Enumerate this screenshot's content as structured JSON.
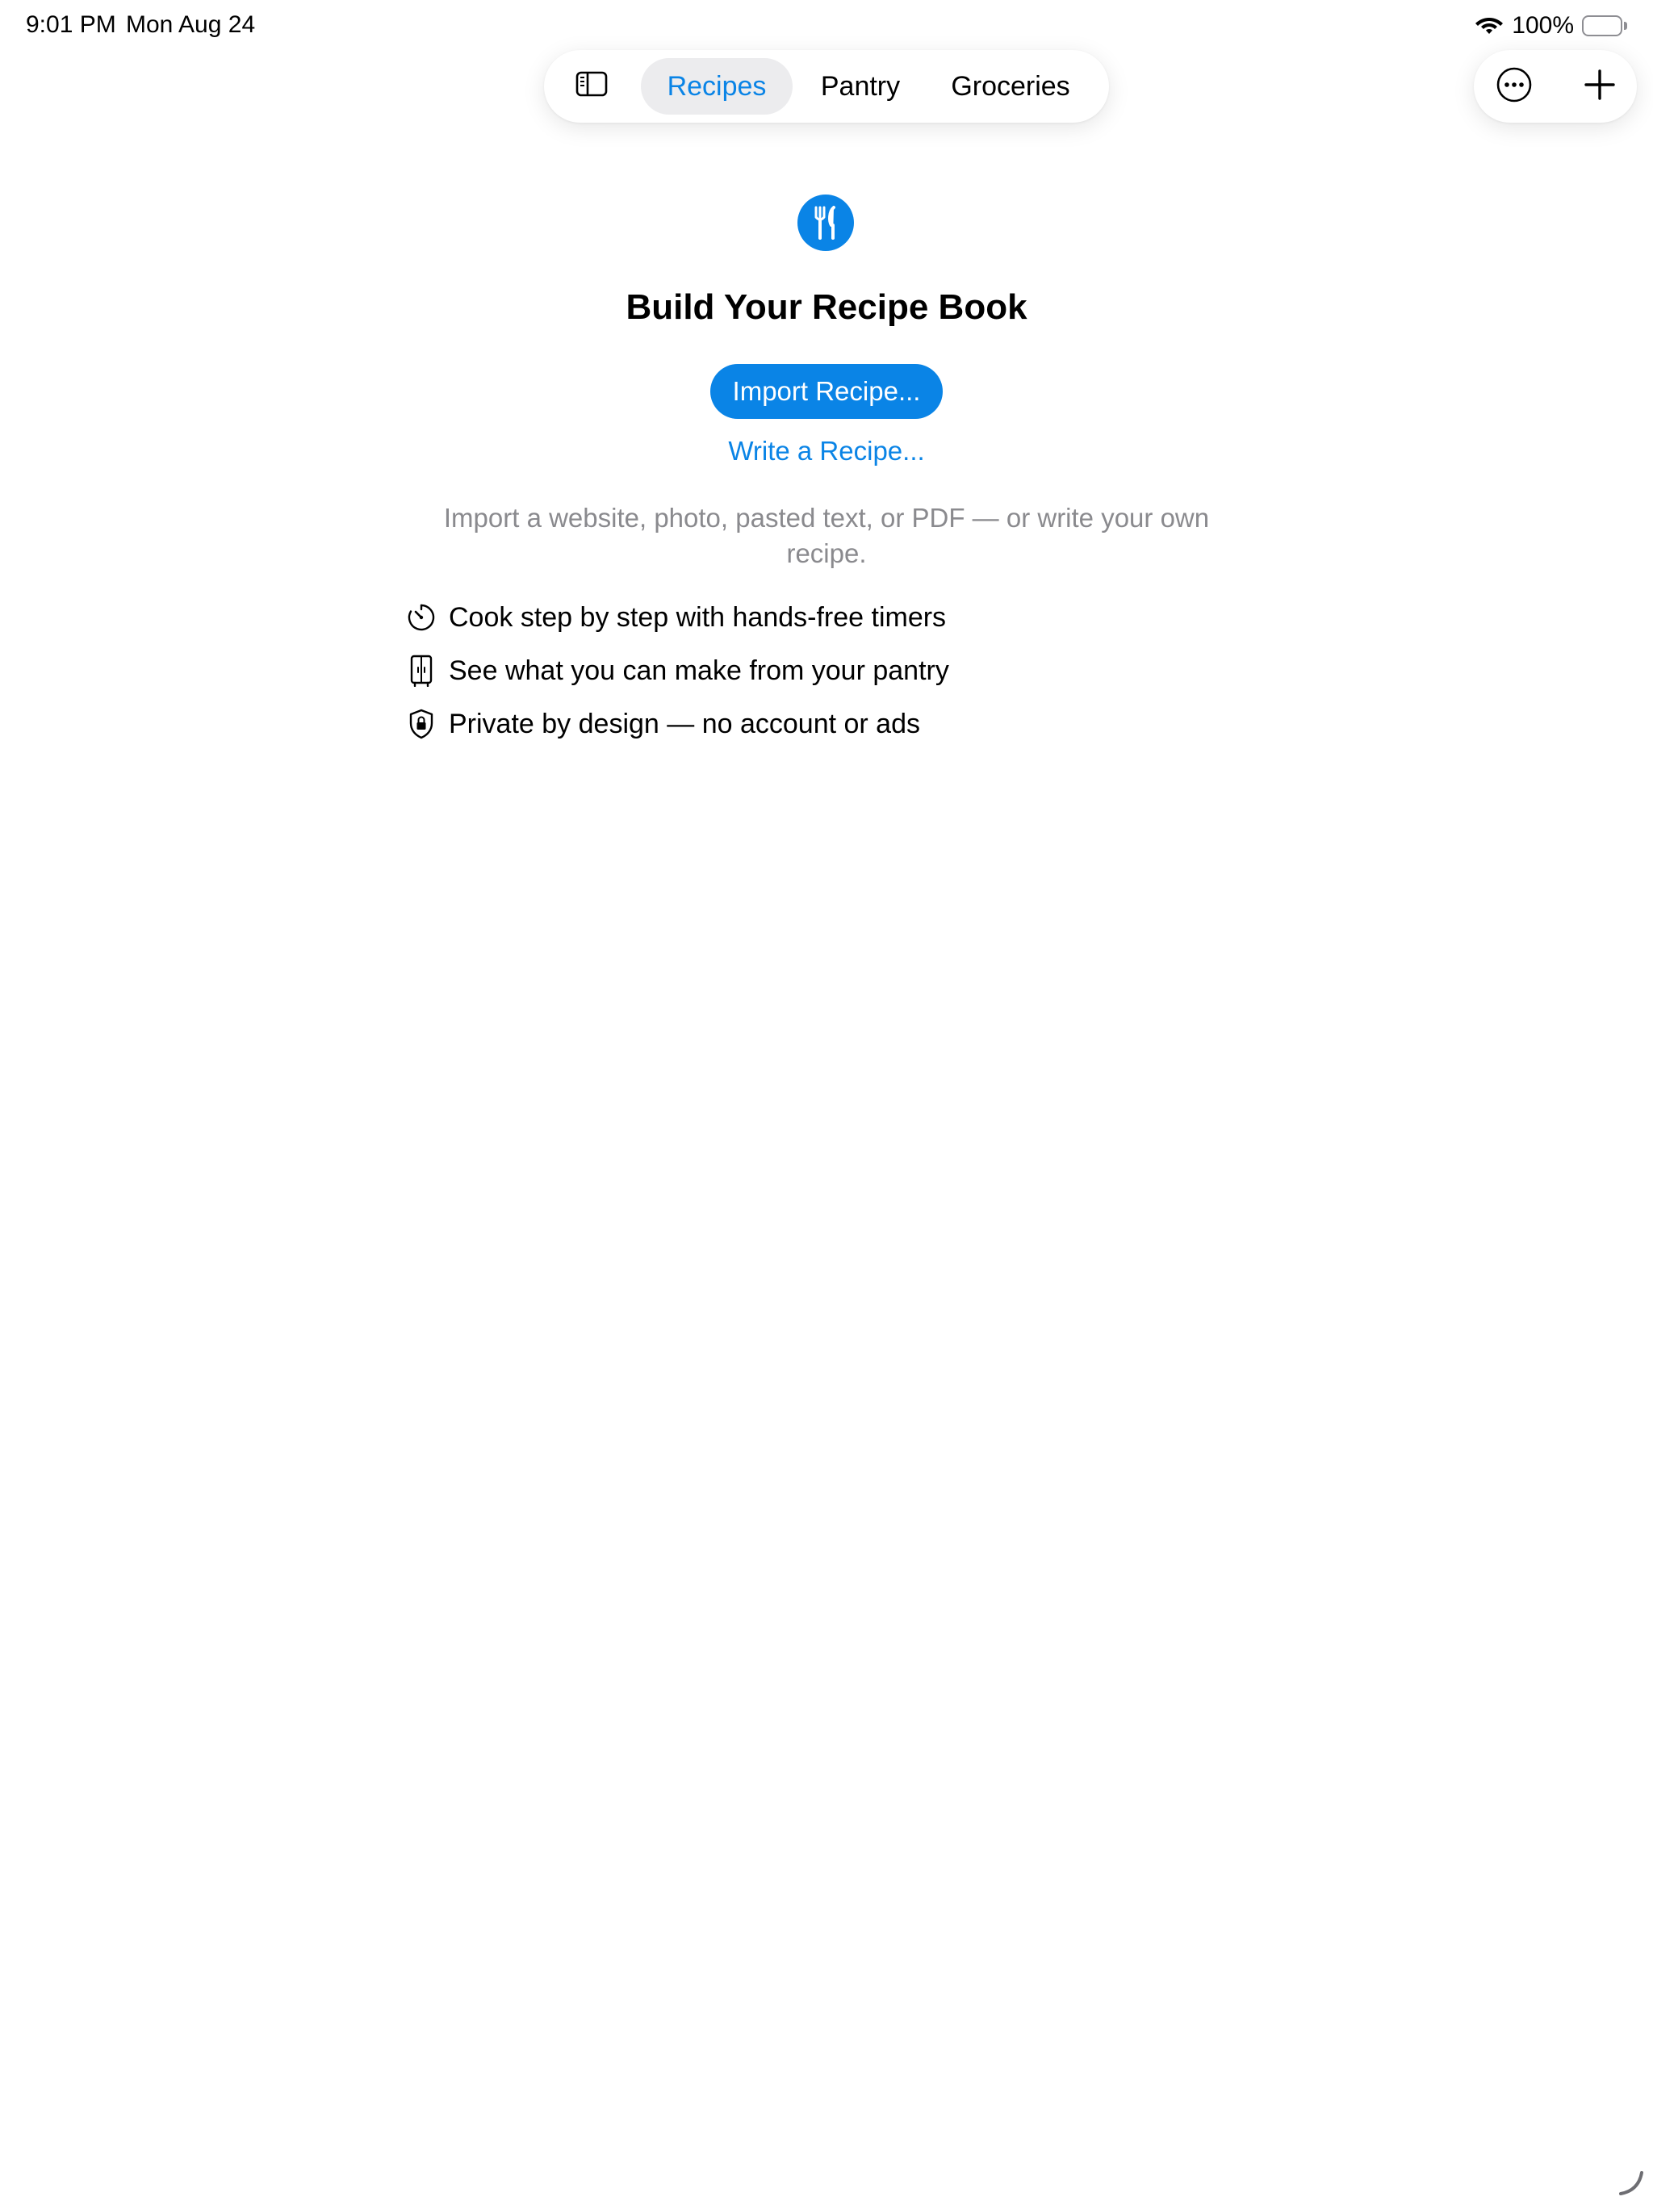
{
  "status_bar": {
    "time": "9:01 PM",
    "date": "Mon Aug 24",
    "battery_percent": "100%",
    "battery_level": 1.0
  },
  "nav": {
    "sidebar_icon": "sidebar-left-icon",
    "tabs": [
      {
        "label": "Recipes",
        "selected": true
      },
      {
        "label": "Pantry",
        "selected": false
      },
      {
        "label": "Groceries",
        "selected": false
      }
    ]
  },
  "actions": {
    "more_icon": "ellipsis-circle-icon",
    "add_icon": "plus-icon"
  },
  "empty_state": {
    "icon": "fork-knife-icon",
    "title": "Build Your Recipe Book",
    "primary_button": "Import Recipe...",
    "secondary_link": "Write a Recipe...",
    "description": "Import a website, photo, pasted text, or PDF — or write your own recipe.",
    "features": [
      {
        "icon": "timer-icon",
        "text": "Cook step by step with hands-free timers"
      },
      {
        "icon": "refrigerator-icon",
        "text": "See what you can make from your pantry"
      },
      {
        "icon": "lock-shield-icon",
        "text": "Private by design — no account or ads"
      }
    ]
  },
  "colors": {
    "accent": "#0a84e6",
    "secondary_text": "#8a8a8e",
    "selected_tab_bg": "#ececee"
  }
}
